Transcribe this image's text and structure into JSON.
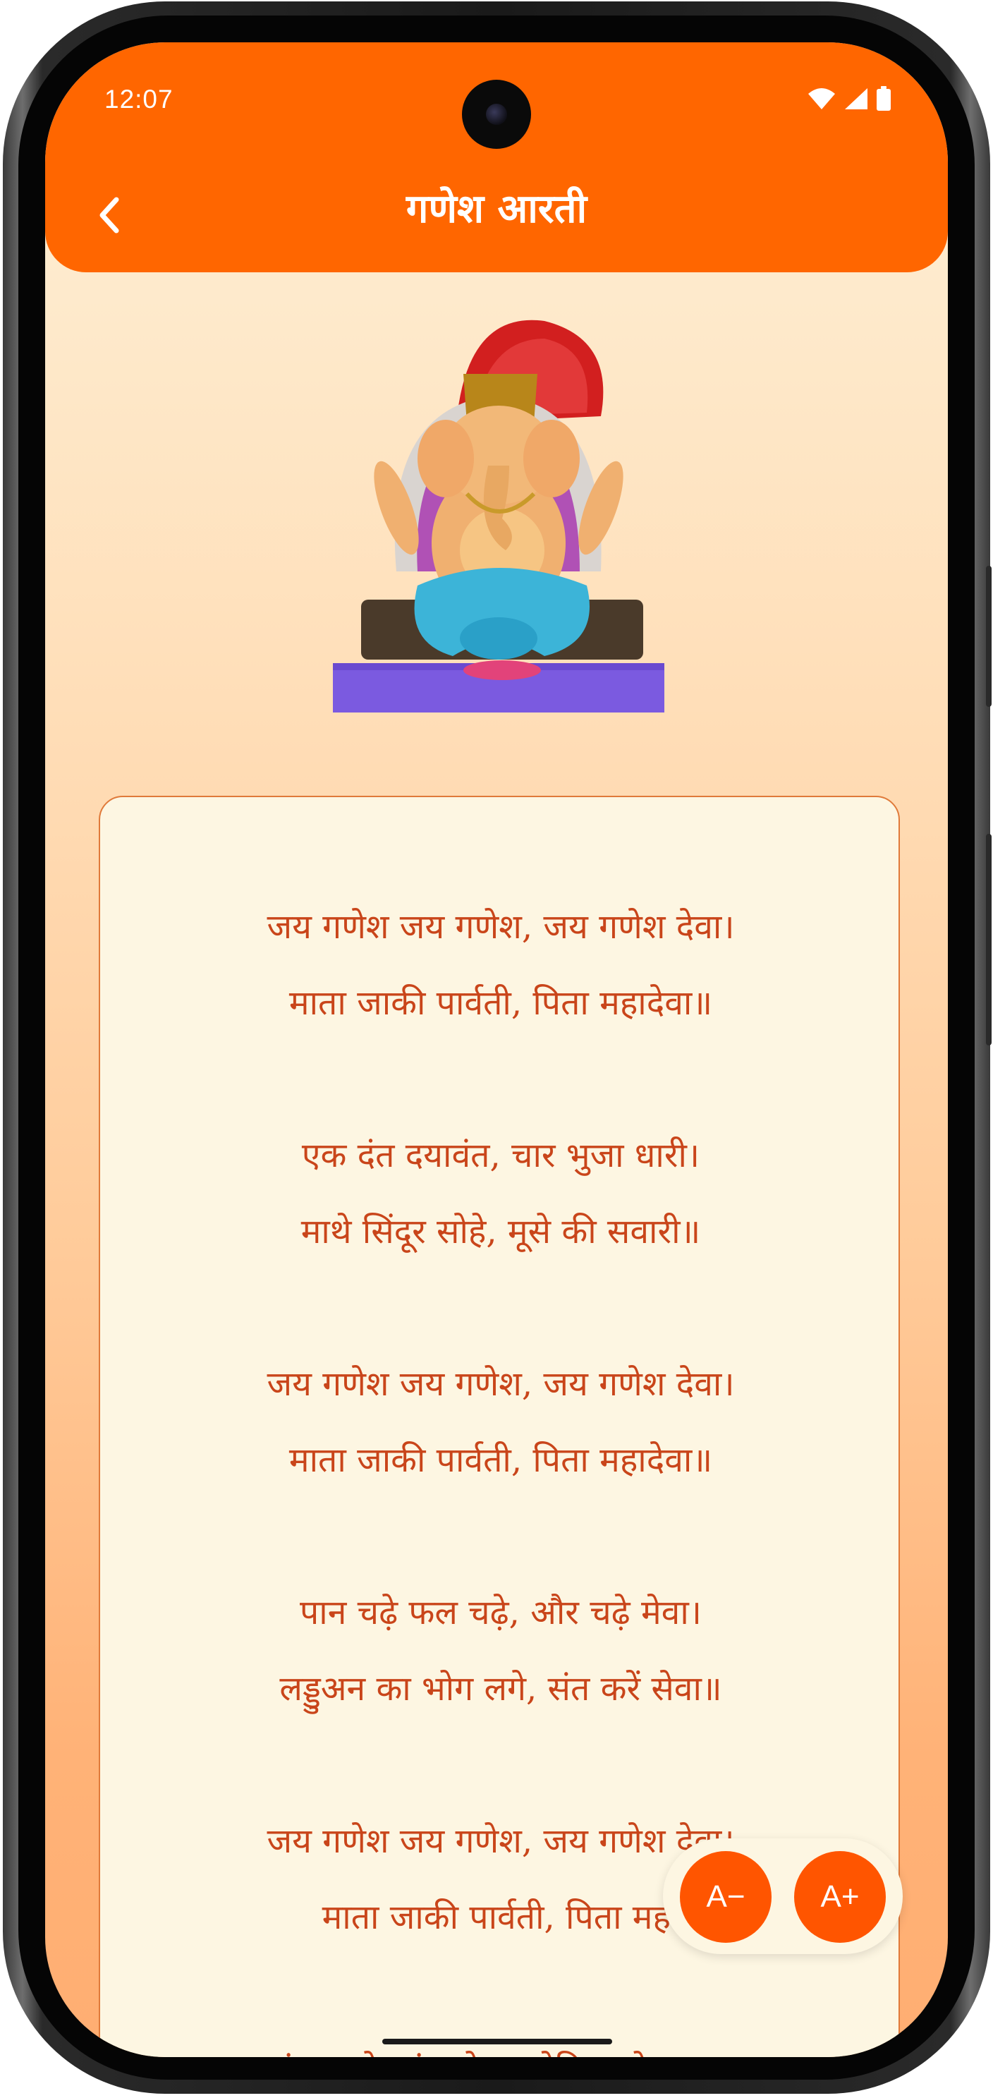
{
  "status_bar": {
    "time": "12:07"
  },
  "header": {
    "title": "गणेश आरती"
  },
  "icons": {
    "back": "chevron-left-icon",
    "wifi": "wifi-icon",
    "signal": "signal-icon",
    "battery": "battery-icon"
  },
  "colors": {
    "header": "#ff6600",
    "lyrics_text": "#c9451a",
    "card_bg": "#fdf6e2",
    "button": "#ff5500"
  },
  "lyrics": {
    "verses": [
      {
        "lines": [
          "जय गणेश जय गणेश, जय गणेश देवा।",
          "माता जाकी पार्वती, पिता महादेवा॥"
        ]
      },
      {
        "lines": [
          "एक दंत दयावंत, चार भुजा धारी।",
          "माथे सिंदूर सोहे, मूसे की सवारी॥"
        ]
      },
      {
        "lines": [
          "जय गणेश जय गणेश, जय गणेश देवा।",
          "माता जाकी पार्वती, पिता महादेवा॥"
        ]
      },
      {
        "lines": [
          "पान चढ़े फल चढ़े, और चढ़े मेवा।",
          "लड्डुअन का भोग लगे, संत करें सेवा॥"
        ]
      },
      {
        "lines": [
          "जय गणेश जय गणेश, जय गणेश देवा।",
          "माता जाकी पार्वती, पिता महा"
        ]
      },
      {
        "lines": [
          "अंधन को आंख देत, कोढ़िन को काया।"
        ]
      }
    ]
  },
  "font_controls": {
    "decrease": "A−",
    "increase": "A+"
  }
}
